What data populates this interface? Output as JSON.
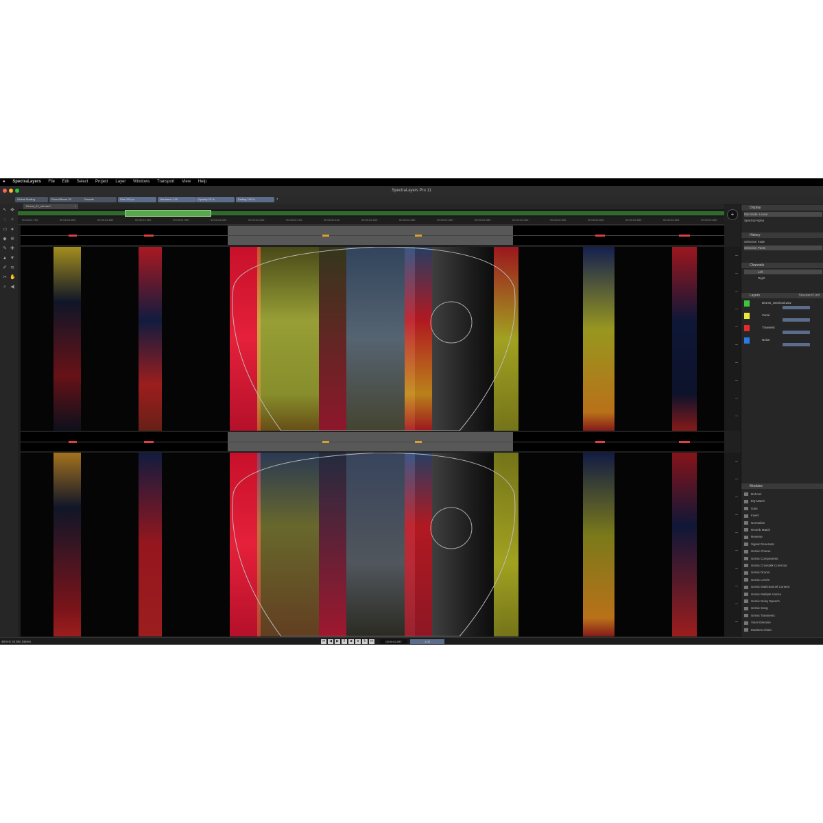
{
  "menubar": {
    "apple": "",
    "items": [
      "SpectraLayers",
      "File",
      "Edit",
      "Select",
      "Project",
      "Layer",
      "Windows",
      "Transport",
      "View",
      "Help"
    ]
  },
  "window": {
    "title": "SpectraLayers Pro 11",
    "traffic_colors": [
      "#ff5f57",
      "#febc2e",
      "#28c840"
    ]
  },
  "toolbar": {
    "pills": [
      "Global Scaling",
      "Round Brush 25",
      "Smooth",
      "Size 100 px",
      "Hardness 1.00",
      "Opacity 25 %",
      "Fading 100 %"
    ],
    "chevron": "›"
  },
  "file_tab": {
    "label": "Drums_01_unt.wav*",
    "close": "×"
  },
  "ruler_ticks": [
    "00:00:01.750",
    "00:00:01.800",
    "00:00:01.850",
    "00:00:01.900",
    "00:00:01.950",
    "00:00:02.000",
    "00:00:02.050",
    "00:00:02.100",
    "00:00:02.150",
    "00:00:02.200",
    "00:00:02.250",
    "00:00:02.300",
    "00:00:02.350",
    "00:00:02.400",
    "00:00:02.450",
    "00:00:02.500",
    "00:00:02.550",
    "00:00:02.600",
    "00:00:02.650"
  ],
  "right_panel": {
    "display": {
      "header": "Display",
      "rows": [
        "Mix Mode: Linear",
        "Spectral Alpha"
      ]
    },
    "history": {
      "header": "History",
      "rows": [
        "Selection Fade",
        "Selection Paste"
      ]
    },
    "channels": {
      "header": "Channels",
      "rows": [
        "Left",
        "Right"
      ]
    },
    "layers": {
      "header": "Layers",
      "mode": "Standard Unit",
      "items": [
        {
          "name": "Drums_Unmixed.wav",
          "color": "#3ec43e"
        },
        {
          "name": "Vocal",
          "color": "#e8e83a"
        },
        {
          "name": "Transient",
          "color": "#e52a2a"
        },
        {
          "name": "Noise",
          "color": "#2a7ae5"
        }
      ]
    },
    "modules": {
      "header": "Modules",
      "items": [
        "Dehowl",
        "EQ Match",
        "Gain",
        "Invert",
        "Normalize",
        "Reverb Match",
        "Reverse",
        "Signal Generator",
        "Unmix Chorus",
        "Unmix Components",
        "Unmix Crosstalk Corrector",
        "Unmix Drums",
        "Unmix Levels",
        "Unmix Multichannel Content",
        "Unmix Multiple Voices",
        "Unmix Noisy Speech",
        "Unmix Song",
        "Unmix Transients",
        "Voice Denoise",
        "Modules Chain"
      ]
    }
  },
  "status": {
    "text": "48 kHz 24 bits Stereo",
    "time": "00:00:02.087",
    "zoom": "1.00"
  }
}
